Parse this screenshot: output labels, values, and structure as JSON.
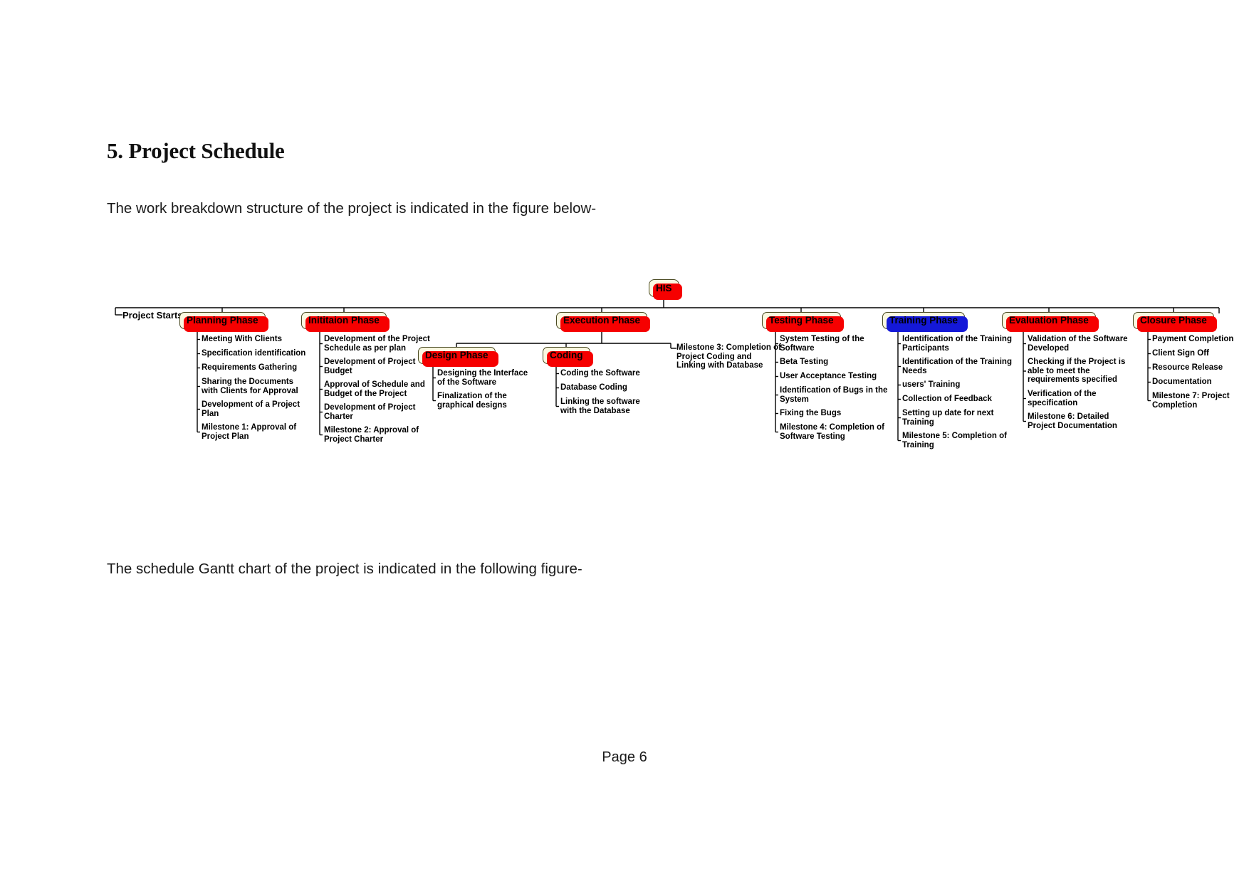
{
  "document": {
    "heading": "5. Project Schedule",
    "intro_paragraph": "The work breakdown structure of the project is indicated in the figure below-",
    "gantt_paragraph": "The schedule Gantt chart of the project is indicated in the following figure-",
    "footer": "Page 6"
  },
  "wbs": {
    "root": {
      "label": "HIS",
      "shadow_color": "#f60000"
    },
    "start_label": "Project Starts",
    "node_fill": "#faf8e0",
    "node_border": "#4a4a22",
    "shadow_red": "#f60000",
    "shadow_blue": "#1418d8",
    "connector_color": "#000000",
    "phases": [
      {
        "label": "Planning Phase",
        "shadow_color": "#f60000",
        "tasks": [
          "Meeting With Clients",
          "Specification identification",
          "Requirements Gathering",
          "Sharing the Documents with Clients for Approval",
          "Development of a Project Plan",
          "Milestone 1: Approval of Project Plan"
        ]
      },
      {
        "label": "Inititaion Phase",
        "shadow_color": "#f60000",
        "tasks": [
          "Development of the Project Schedule as per plan",
          "Development of Project Budget",
          "Approval of Schedule and Budget of the Project",
          "Development of Project Charter",
          "Milestone 2: Approval of Project Charter"
        ]
      },
      {
        "label": "Execution Phase",
        "shadow_color": "#f60000",
        "subphases": [
          {
            "label": "Design Phase",
            "shadow_color": "#f60000",
            "tasks": [
              "Designing the Interface of the Software",
              "Finalization of the graphical designs"
            ]
          },
          {
            "label": "Coding",
            "shadow_color": "#f60000",
            "tasks": [
              "Coding the Software",
              "Database Coding",
              "Linking the software with the Database"
            ]
          }
        ],
        "tasks": [
          "Milestone 3: Completion of Project Coding and Linking with Database"
        ]
      },
      {
        "label": "Testing Phase",
        "shadow_color": "#f60000",
        "tasks": [
          "System Testing of the Software",
          "Beta Testing",
          "User Acceptance Testing",
          "Identification of Bugs in the System",
          "Fixing the Bugs",
          "Milestone 4: Completion of Software Testing"
        ]
      },
      {
        "label": "Training Phase",
        "shadow_color": "#1418d8",
        "tasks": [
          "Identification of the Training Participants",
          "Identification of the Training Needs",
          "users' Training",
          "Collection of Feedback",
          "Setting up date for next Training",
          "Milestone 5: Completion of Training"
        ]
      },
      {
        "label": "Evaluation Phase",
        "shadow_color": "#f60000",
        "tasks": [
          "Validation of the Software Developed",
          "Checking if the Project is able to meet the requirements specified",
          "Verification of the specification",
          "Milestone 6: Detailed Project Documentation"
        ]
      },
      {
        "label": "Closure Phase",
        "shadow_color": "#f60000",
        "tasks": [
          "Payment Completion",
          "Client Sign Off",
          "Resource Release",
          "Documentation",
          "Milestone 7: Project Completion"
        ]
      }
    ]
  }
}
